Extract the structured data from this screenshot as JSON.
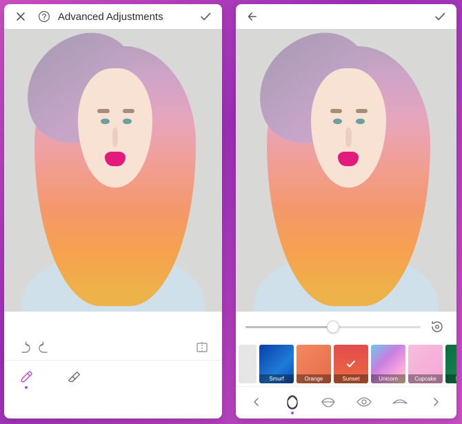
{
  "left": {
    "header": {
      "title": "Advanced Adjustments"
    },
    "tools": {
      "brush_active": true
    }
  },
  "right": {
    "slider": {
      "value_pct": 50
    },
    "swatches": [
      {
        "id": "smurf",
        "label": "Smurf"
      },
      {
        "id": "orange",
        "label": "Orange"
      },
      {
        "id": "sunset",
        "label": "Sunset",
        "selected": true
      },
      {
        "id": "unicorn",
        "label": "Unicorn"
      },
      {
        "id": "cupcake",
        "label": "Cupcake"
      },
      {
        "id": "sprite",
        "label": "Sprite"
      }
    ]
  }
}
